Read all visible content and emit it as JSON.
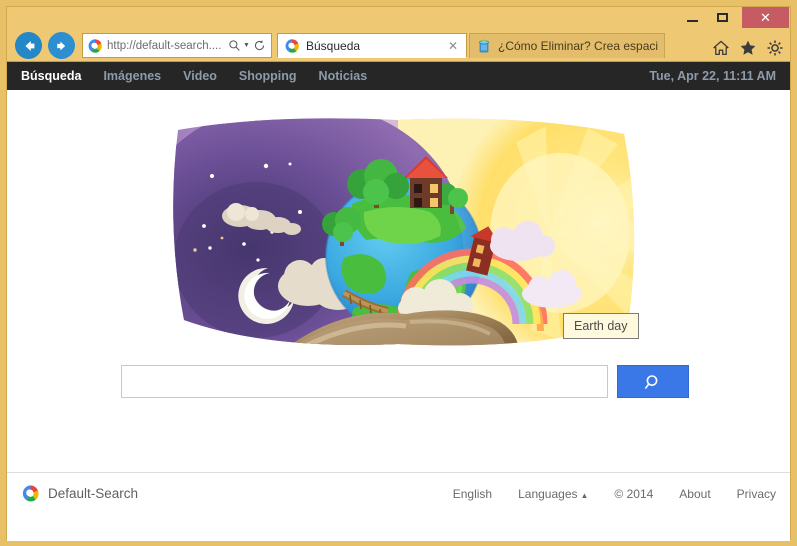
{
  "window": {
    "controls": {
      "minimize": "minimize-button",
      "maximize": "maximize-button",
      "close": "✕"
    }
  },
  "browser": {
    "back_icon": "back-arrow-icon",
    "forward_icon": "forward-arrow-icon",
    "address": {
      "url": "http://default-search....",
      "placeholder": "http://default-search....",
      "search_icon": "magnifier-icon",
      "dropdown_icon": "chevron-down-icon",
      "refresh_icon": "refresh-icon"
    },
    "tabs": [
      {
        "title": "Búsqueda",
        "favicon": "default-search-favicon",
        "active": true,
        "close_label": "✕"
      },
      {
        "title": "¿Cómo Eliminar? Crea espaci...",
        "favicon": "trash-bin-favicon",
        "active": false,
        "close_label": ""
      }
    ],
    "commands": [
      {
        "name": "home-icon",
        "label": "Home"
      },
      {
        "name": "favorites-icon",
        "label": "Favorites"
      },
      {
        "name": "tools-icon",
        "label": "Tools"
      }
    ]
  },
  "site": {
    "nav": [
      {
        "label": "Búsqueda",
        "active": true
      },
      {
        "label": "Imágenes",
        "active": false
      },
      {
        "label": "Video",
        "active": false
      },
      {
        "label": "Shopping",
        "active": false
      },
      {
        "label": "Noticias",
        "active": false
      }
    ],
    "date": "Tue, Apr 22, 11:11 AM",
    "doodle": {
      "alt": "Earth day doodle — planet earth held in a hand between night and sunrise",
      "tooltip": "Earth day"
    },
    "search": {
      "value": "",
      "placeholder": "",
      "button_icon": "magnifier-icon",
      "button_label": ""
    },
    "footer": {
      "brand": "Default-Search",
      "brand_icon": "default-search-logo",
      "links": [
        {
          "label": "English"
        },
        {
          "label": "Languages"
        },
        {
          "label": "© 2014"
        },
        {
          "label": "About"
        },
        {
          "label": "Privacy"
        }
      ],
      "languages_caret": "▲"
    }
  },
  "colors": {
    "window_chrome": "#efc873",
    "close_button": "#c75b64",
    "nav_arrow": "#2387c8",
    "site_bar": "#262626",
    "site_nav_text": "#8e9bab",
    "search_button": "#3b78e7",
    "footer_text": "#6b6b6b"
  }
}
